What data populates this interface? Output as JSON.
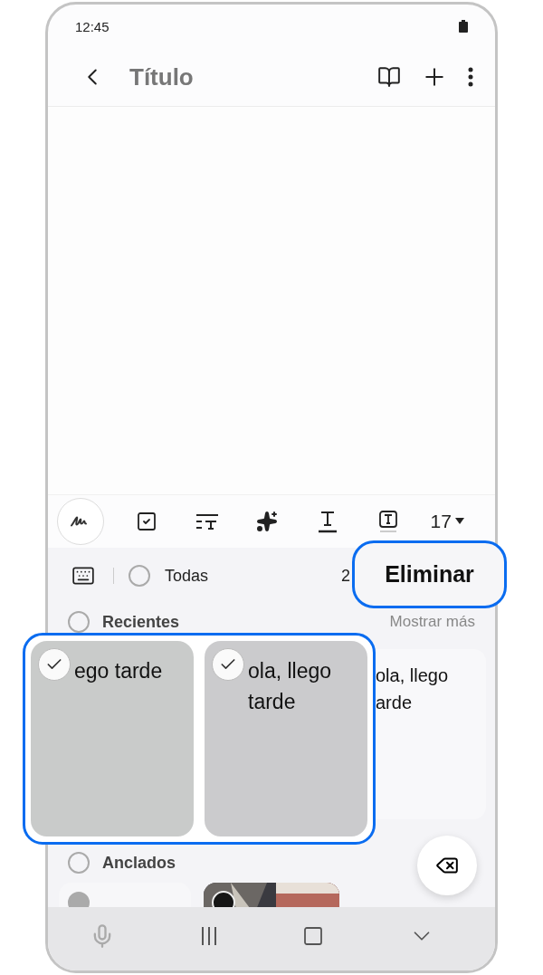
{
  "status_bar": {
    "time": "12:45"
  },
  "header": {
    "title": "Título"
  },
  "toolbar": {
    "tools": [
      {
        "kind": "pen"
      },
      {
        "kind": "checklist"
      },
      {
        "kind": "paragraph"
      },
      {
        "kind": "sparkle"
      },
      {
        "kind": "underline"
      },
      {
        "kind": "textbox"
      }
    ],
    "font_size": "17"
  },
  "clipboard": {
    "select_all": {
      "label": "Todas",
      "checked": false
    },
    "count": "2",
    "delete_button": {
      "label": "Eliminar",
      "highlighted": true
    },
    "recent": {
      "label": "Recientes",
      "checked": false,
      "action": "Mostrar más",
      "cards": [
        {
          "lines": [
            "ola, llego",
            "arde"
          ]
        }
      ]
    },
    "selected_cards": {
      "highlighted": true,
      "cards": [
        {
          "text": "ego tarde",
          "checked": true
        },
        {
          "text": "ola, llego tarde",
          "checked": true
        }
      ]
    },
    "pinned": {
      "label": "Anclados",
      "checked": false,
      "cards": [
        {
          "kind": "text",
          "disabled": true
        },
        {
          "kind": "picture"
        }
      ]
    }
  }
}
